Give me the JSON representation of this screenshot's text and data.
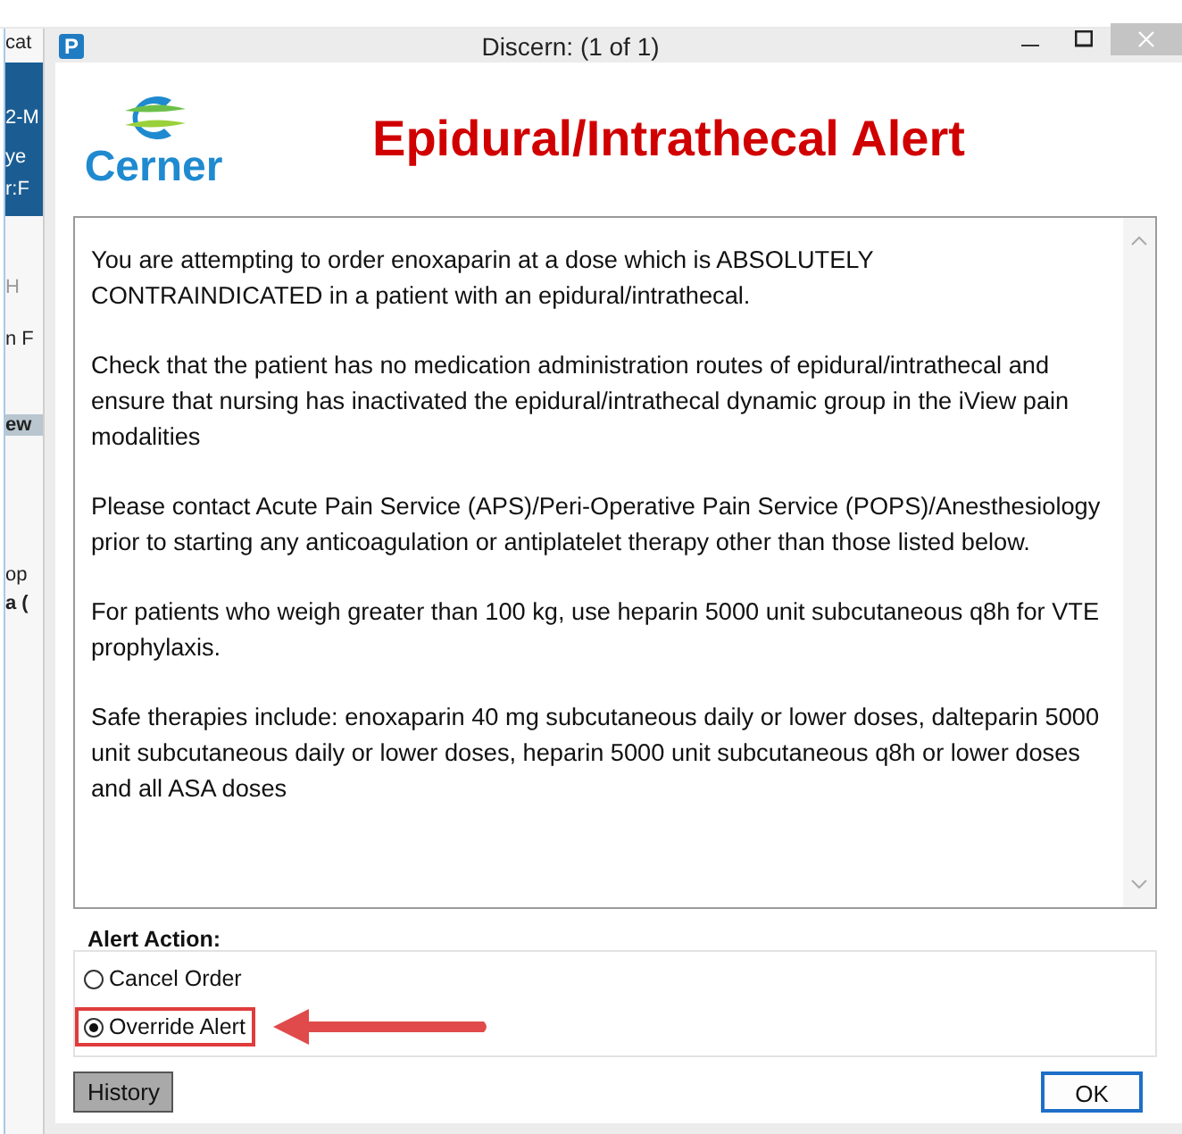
{
  "background_window": {
    "fragments": [
      {
        "text": "cat",
        "kind": "plain"
      },
      {
        "text": "2-M",
        "kind": "banner"
      },
      {
        "text": "ye",
        "kind": "banner"
      },
      {
        "text": "r:F",
        "kind": "banner"
      },
      {
        "text": "H",
        "kind": "faint"
      },
      {
        "text": "n F",
        "kind": "plain"
      },
      {
        "text": "ew",
        "kind": "header"
      },
      {
        "text": "op",
        "kind": "plain"
      },
      {
        "text": "a (",
        "kind": "bold"
      }
    ]
  },
  "window": {
    "app_icon": "P",
    "title": "Discern:  (1 of 1)"
  },
  "logo": {
    "text": "Cerner"
  },
  "alert_title": "Epidural/Intrathecal Alert",
  "message": [
    "You are attempting to order enoxaparin at a dose which is ABSOLUTELY CONTRAINDICATED in a patient with an epidural/intrathecal.",
    "Check that the patient has no medication administration routes of epidural/intrathecal and ensure that nursing has inactivated the epidural/intrathecal dynamic group in the iView pain modalities",
    "Please contact Acute Pain Service (APS)/Peri-Operative Pain Service (POPS)/Anesthesiology prior to starting any anticoagulation or antiplatelet therapy other than those listed below.",
    "For patients who weigh greater than 100 kg, use heparin 5000 unit subcutaneous q8h for VTE prophylaxis.",
    "Safe therapies include: enoxaparin 40 mg subcutaneous daily or lower doses, dalteparin 5000 unit subcutaneous daily or lower doses, heparin 5000 unit subcutaneous q8h or lower doses and all ASA doses"
  ],
  "alert_action": {
    "label": "Alert Action:",
    "options": [
      {
        "label": "Cancel Order",
        "selected": false,
        "highlighted": false
      },
      {
        "label": "Override Alert",
        "selected": true,
        "highlighted": true
      }
    ]
  },
  "buttons": [
    {
      "label": "History",
      "kind": "secondary"
    },
    {
      "label": "OK",
      "kind": "default"
    }
  ]
}
